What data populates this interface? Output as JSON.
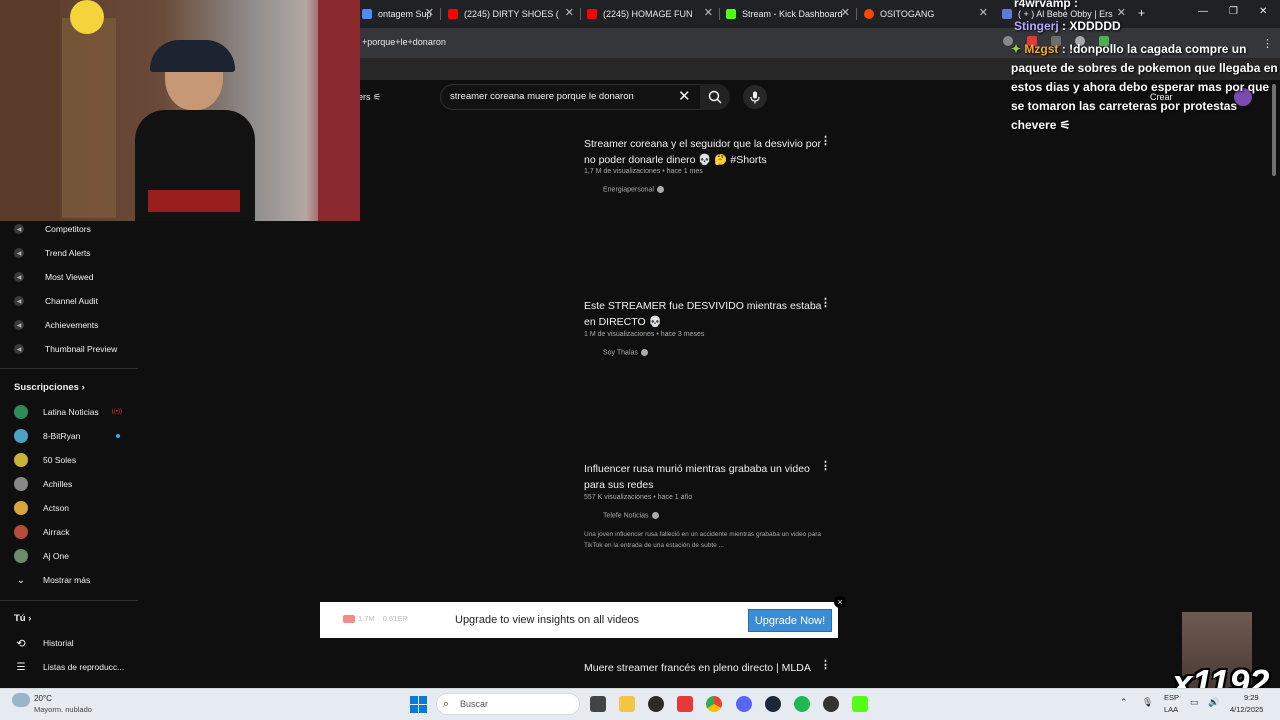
{
  "browser": {
    "tabs": [
      {
        "label": "ontagem Sup",
        "icon": "window-icon",
        "color": "#4c8bf5"
      },
      {
        "label": "(2245) DIRTY SHOES (",
        "icon": "youtube-icon",
        "color": "#ff0000"
      },
      {
        "label": "(2245) HOMAGE FUN",
        "icon": "youtube-icon",
        "color": "#ff0000"
      },
      {
        "label": "Stream - Kick Dashboard",
        "icon": "kick-icon",
        "color": "#53fc18"
      },
      {
        "label": "OSITOGANG",
        "icon": "reddit-icon",
        "color": "#ff4500"
      },
      {
        "label": "( + ) Al Bebé Obby | Ers",
        "icon": "roblox-icon",
        "color": "#5a7bd6"
      }
    ],
    "address": "+porque+le+donaron",
    "new_tab": "+"
  },
  "search": {
    "query": "streamer coreana muere porque le donaron",
    "filters_label": "ers"
  },
  "sidebar": {
    "tool_items": [
      {
        "label": "Competitors"
      },
      {
        "label": "Trend Alerts"
      },
      {
        "label": "Most Viewed"
      },
      {
        "label": "Channel Audit"
      },
      {
        "label": "Achievements"
      },
      {
        "label": "Thumbnail Preview"
      }
    ],
    "subscriptions_title": "Suscripciones",
    "subscriptions": [
      {
        "label": "Latina Noticias",
        "color": "#2e8b57",
        "badge": "live"
      },
      {
        "label": "8-BitRyan",
        "color": "#4aa3c7",
        "badge": "dot"
      },
      {
        "label": "50 Soles",
        "color": "#c9b33a",
        "badge": ""
      },
      {
        "label": "Achilles",
        "color": "#888888",
        "badge": ""
      },
      {
        "label": "Actson",
        "color": "#d6a63b",
        "badge": ""
      },
      {
        "label": "Airrack",
        "color": "#b54b3b",
        "badge": ""
      },
      {
        "label": "Aj One",
        "color": "#6d8a6a",
        "badge": ""
      }
    ],
    "show_more": "Mostrar más",
    "you_title": "Tú",
    "you_items": [
      {
        "label": "Historial",
        "icon": "history-icon"
      },
      {
        "label": "Listas de reproducc...",
        "icon": "playlist-icon"
      }
    ]
  },
  "results": [
    {
      "title": "Streamer coreana y el seguidor que la desvivio por no poder donarle dinero 💀 🤔 #Shorts",
      "meta": "1,7 M de visualizaciones • hace 1 mes",
      "channel": "Energiapersonal",
      "description": ""
    },
    {
      "title": "Este STREAMER fue DESVIVIDO mientras estaba en DIRECTO 💀",
      "meta": "1 M de visualizaciones • hace 3 meses",
      "channel": "Soy Thalas",
      "description": ""
    },
    {
      "title": "Influencer rusa murió mientras grababa un video para sus redes",
      "meta": "557 K visualizaciones • hace 1 año",
      "channel": "Telefe Noticias",
      "description": "Una joven influencer rusa falleció en un accidente mientras grababa un video para TikTok en la entrada de una estación de subte ..."
    },
    {
      "title": "Muere streamer francés en pleno directo | MLDA",
      "meta": "",
      "channel": "",
      "description": ""
    }
  ],
  "upgrade_banner": {
    "views": "1.7M",
    "ratio": "0.61",
    "ratio_unit": "ER",
    "message": "Upgrade to view insights on all videos",
    "button": "Upgrade Now!",
    "close": "×"
  },
  "chat": {
    "lines": [
      {
        "user": "r4wrvamp",
        "text": ":",
        "color": "#ffffff"
      },
      {
        "user": "Stingerj",
        "text": ": XDDDDD",
        "color": "#ffffff"
      },
      {
        "user": "Mzgst",
        "text": ": !donpollo la cagada compre un",
        "color": "#f0a830"
      },
      {
        "user": "",
        "text": "paquete de sobres de pokemon que llegaba en",
        "color": "#ffffff"
      },
      {
        "user": "",
        "text": "estos dias y ahora debo esperar mas por que",
        "color": "#ffffff"
      },
      {
        "user": "",
        "text": "se tomaron las carreteras por protestas",
        "color": "#ffffff"
      },
      {
        "user": "",
        "text": "chevere",
        "color": "#ffffff"
      }
    ]
  },
  "overlay": {
    "counter": "x1192",
    "yt_create": "Crear"
  },
  "taskbar": {
    "weather_temp": "20°C",
    "weather_desc": "Mayorm. nublado",
    "search_placeholder": "Buscar",
    "lang_top": "ESP",
    "lang_bottom": "LAA",
    "time": "9:29",
    "date": "4/12/2025"
  }
}
